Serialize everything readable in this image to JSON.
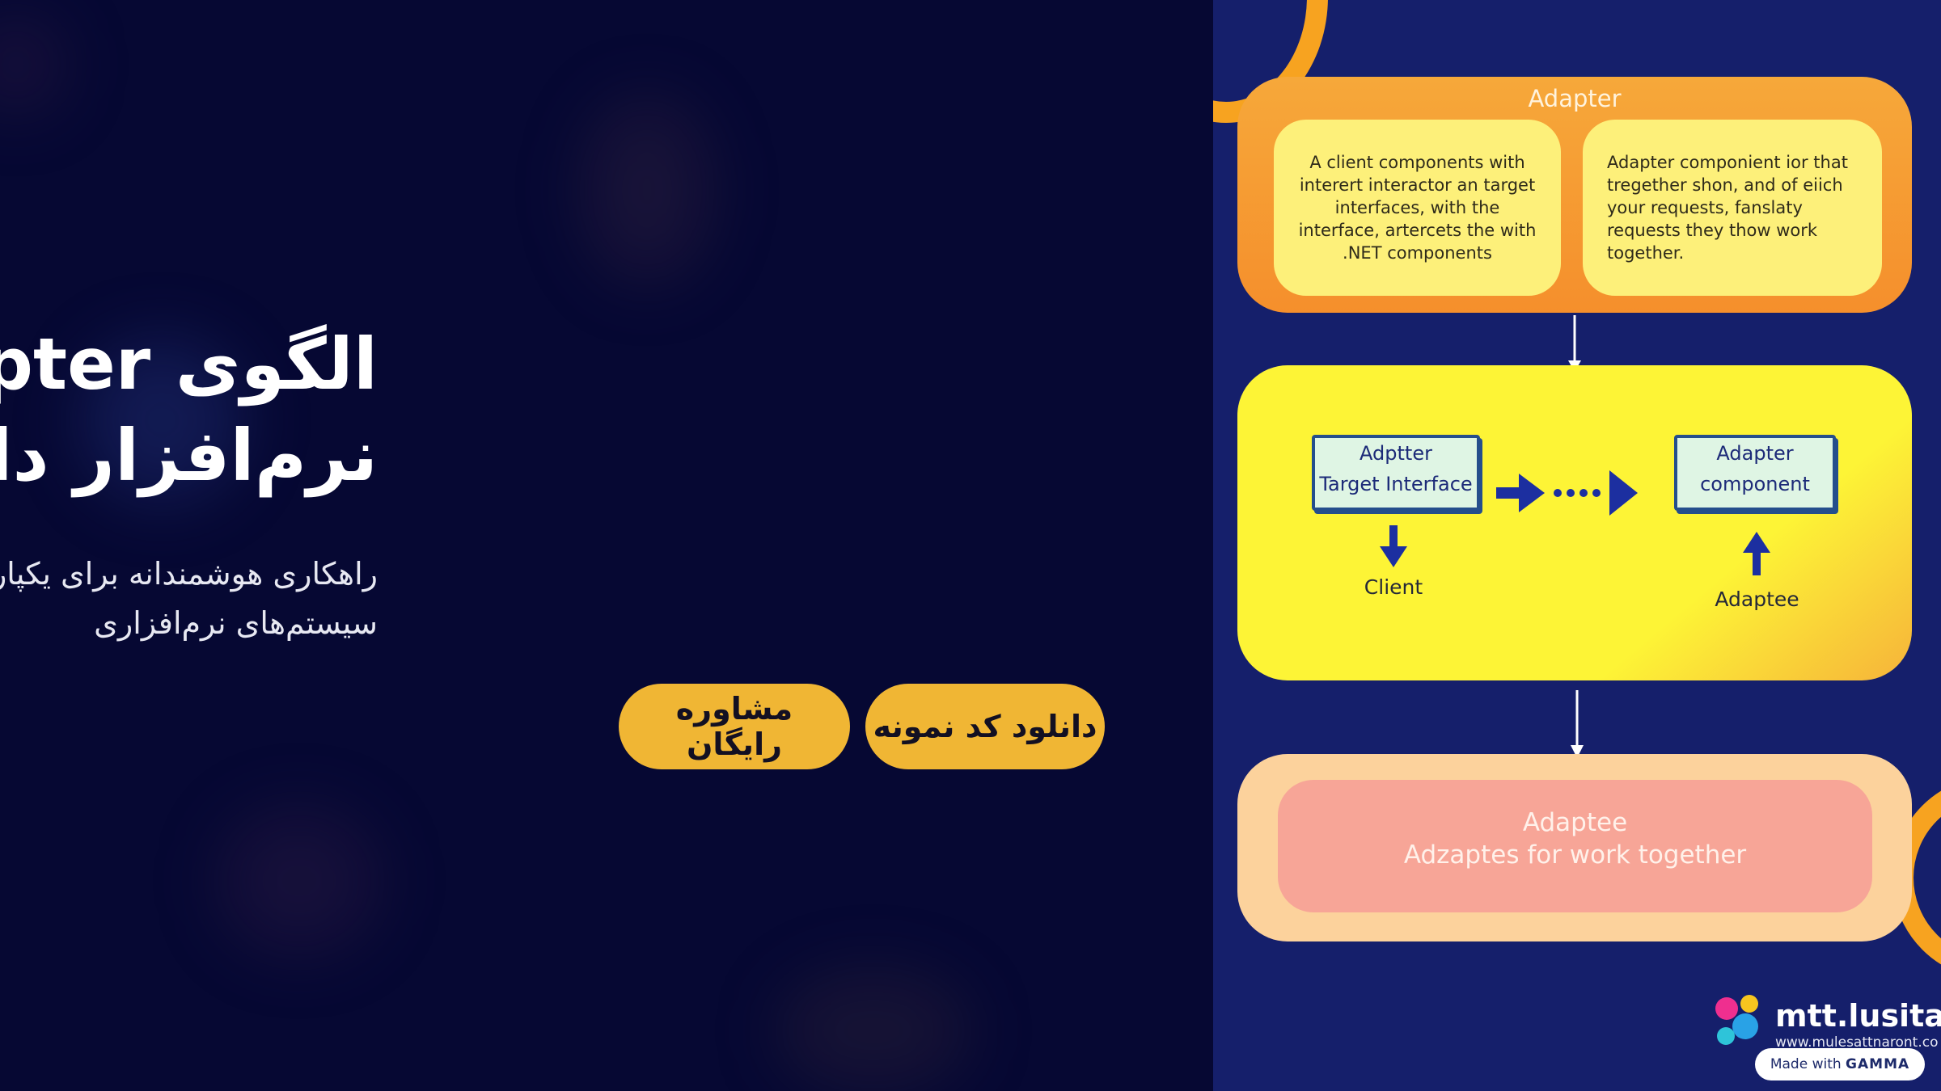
{
  "hero": {
    "title": "الگوی Adapter در معماری نرم‌افزار دات‌نت",
    "subtitle": "راهکاری هوشمندانه برای یکپارچه‌سازی اینترفیس‌های ناسازگار در سیستم‌های نرم‌افزاری",
    "buttons": {
      "download_code": "دانلود کد نمونه",
      "free_consult": "مشاوره رایگان"
    }
  },
  "diagram": {
    "top_title": "Adapter",
    "top_left_text": "A client components with interert interactor an target interfaces, with the interface, artercets the with .NET components",
    "top_right_text": "Adapter componient ior that tregether shon, and of eiich your requests, fanslaty requests they thow work together.",
    "target_box_line1": "Adptter",
    "target_box_line2": "Target Interface",
    "component_box_line1": "Adapter",
    "component_box_line2": "component",
    "client_label": "Client",
    "adaptee_label": "Adaptee",
    "bottom_line1": "Adaptee",
    "bottom_line2": "Adzaptes for work together"
  },
  "logo": {
    "name": "mtt.lusitarn",
    "url_text": "www.mulesattnaront.co"
  },
  "watermark": {
    "prefix": "Made with",
    "brand": "GAMMA"
  },
  "colors": {
    "background": "#060833",
    "accent": "#f0b634",
    "panel": "#151f6b"
  }
}
